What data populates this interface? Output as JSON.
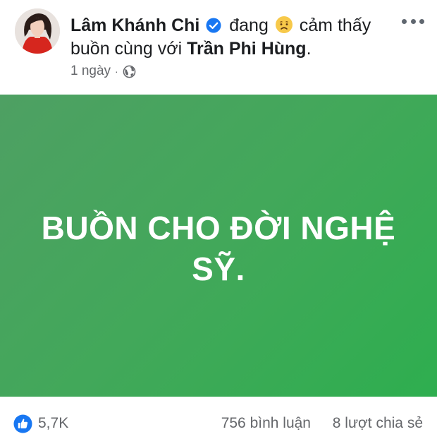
{
  "post": {
    "author": "Lâm Khánh Chi",
    "feeling_prefix": "đang",
    "feeling_text": "cảm thấy",
    "feeling_line2": "buồn cùng với",
    "tagged_person": "Trần Phi Hùng",
    "period": ".",
    "timestamp": "1 ngày",
    "separator": "·",
    "icons": {
      "verified": "verified-badge-icon",
      "feeling": "sad-face-emoji-icon",
      "audience": "globe-icon",
      "more": "more-options-icon",
      "like": "like-reaction-icon"
    },
    "colors": {
      "verified": "#1877f2",
      "banner_start": "#4ea063",
      "banner_end": "#2eae4f",
      "like": "#1877f2"
    }
  },
  "banner": {
    "line1": "BUỒN CHO ĐỜI NGHỆ",
    "line2": "SỸ."
  },
  "stats": {
    "likes": "5,7K",
    "comments": "756 bình luận",
    "shares": "8 lượt chia sẻ"
  }
}
